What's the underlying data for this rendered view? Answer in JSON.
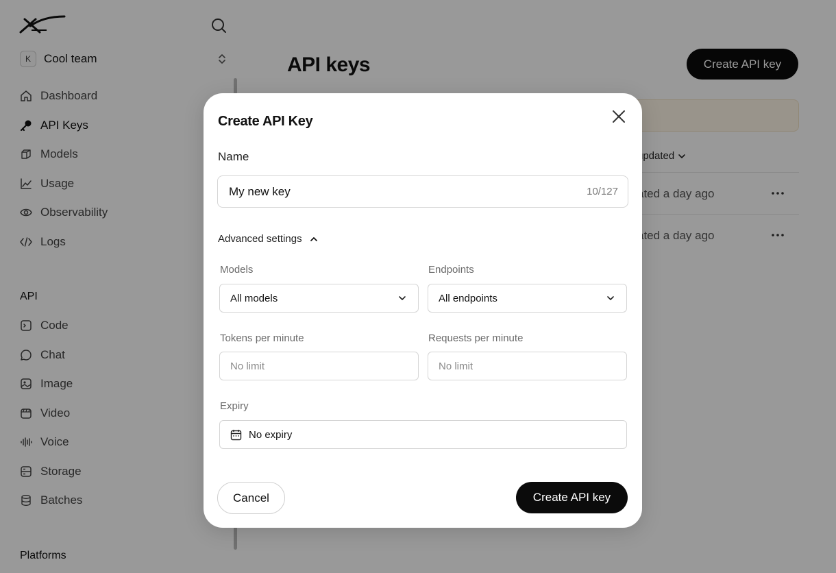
{
  "sidebar": {
    "team": {
      "initial": "K",
      "name": "Cool team"
    },
    "main_items": [
      {
        "label": "Dashboard"
      },
      {
        "label": "API Keys"
      },
      {
        "label": "Models"
      },
      {
        "label": "Usage"
      },
      {
        "label": "Observability"
      },
      {
        "label": "Logs"
      }
    ],
    "api_section_title": "API",
    "api_items": [
      {
        "label": "Code"
      },
      {
        "label": "Chat"
      },
      {
        "label": "Image"
      },
      {
        "label": "Video"
      },
      {
        "label": "Voice"
      },
      {
        "label": "Storage"
      },
      {
        "label": "Batches"
      }
    ],
    "platforms_section_title": "Platforms"
  },
  "main": {
    "title": "API keys",
    "create_button_label": "Create API key",
    "sort_label": "updated",
    "rows": [
      {
        "updated": "ated a day ago"
      },
      {
        "updated": "ated a day ago"
      }
    ]
  },
  "modal": {
    "title": "Create API Key",
    "name_label": "Name",
    "name_value": "My new key",
    "name_counter": "10/127",
    "advanced_label": "Advanced settings",
    "models_label": "Models",
    "models_value": "All models",
    "endpoints_label": "Endpoints",
    "endpoints_value": "All endpoints",
    "tpm_label": "Tokens per minute",
    "tpm_placeholder": "No limit",
    "rpm_label": "Requests per minute",
    "rpm_placeholder": "No limit",
    "expiry_label": "Expiry",
    "expiry_value": "No expiry",
    "cancel_label": "Cancel",
    "create_label": "Create API key"
  },
  "colors": {
    "primary_button": "#0b0b0b",
    "overlay": "rgba(0,0,0,0.40)",
    "notice_bg": "#fff7e8"
  }
}
